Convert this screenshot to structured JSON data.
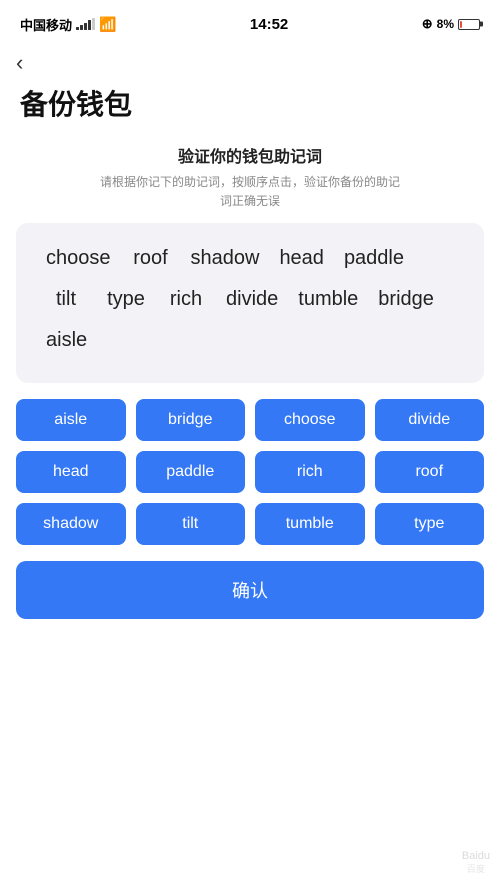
{
  "statusBar": {
    "carrier": "中国移动",
    "time": "14:52",
    "batteryPercent": "8%"
  },
  "back": {
    "label": "‹"
  },
  "pageTitle": "备份钱包",
  "sectionTitle": "验证你的钱包助记词",
  "sectionDesc": "请根据你记下的助记词，按顺序点击，验证你备份的助记\n词正确无误",
  "displayWords": [
    {
      "word": "choose",
      "empty": false
    },
    {
      "word": "roof",
      "empty": false
    },
    {
      "word": "shadow",
      "empty": false
    },
    {
      "word": "head",
      "empty": false
    },
    {
      "word": "paddle",
      "empty": false
    },
    {
      "word": "tilt",
      "empty": false
    },
    {
      "word": "type",
      "empty": false
    },
    {
      "word": "rich",
      "empty": false
    },
    {
      "word": "divide",
      "empty": false
    },
    {
      "word": "tumble",
      "empty": false
    },
    {
      "word": "bridge",
      "empty": false
    },
    {
      "word": "aisle",
      "empty": false
    }
  ],
  "wordButtons": [
    "aisle",
    "bridge",
    "choose",
    "divide",
    "head",
    "paddle",
    "rich",
    "roof",
    "shadow",
    "tilt",
    "tumble",
    "type"
  ],
  "confirmLabel": "确认",
  "watermark": "Baidu"
}
